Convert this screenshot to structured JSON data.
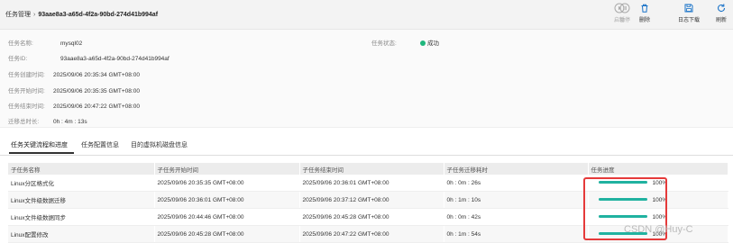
{
  "breadcrumb": {
    "parent": "任务管理",
    "separator": "›",
    "current": "93aae8a3-a65d-4f2a-90bd-274d41b994af"
  },
  "toolbar": [
    {
      "label": "启动",
      "icon": "play-circle-icon",
      "enabled": false
    },
    {
      "label": "暂停",
      "icon": "pause-circle-icon",
      "enabled": false
    },
    {
      "label": "删除",
      "icon": "trash-icon",
      "enabled": true
    },
    {
      "label": "日志下载",
      "icon": "save-icon",
      "enabled": true
    },
    {
      "label": "刷新",
      "icon": "refresh-icon",
      "enabled": true
    }
  ],
  "info": {
    "name_label": "任务名称:",
    "name_value": "mysql02",
    "status_label": "任务状态:",
    "status_value": "成功",
    "status_color": "#20b77d",
    "id_label": "任务ID:",
    "id_value": "93aae8a3-a65d-4f2a-90bd-274d41b994af",
    "created_label": "任务创建时间:",
    "created_value": "2025/09/06 20:35:34 GMT+08:00",
    "started_label": "任务开始时间:",
    "started_value": "2025/09/06 20:35:35 GMT+08:00",
    "ended_label": "任务结束时间:",
    "ended_value": "2025/09/06 20:47:22 GMT+08:00",
    "duration_label": "迁移总时长:",
    "duration_value": "0h : 4m : 13s"
  },
  "tabs": [
    "任务关键流程和进度",
    "任务配置信息",
    "目的虚拟机磁盘信息"
  ],
  "table": {
    "headers": [
      "子任务名称",
      "子任务开始时间",
      "子任务结束时间",
      "子任务迁移耗时",
      "任务进度"
    ],
    "rows": [
      {
        "name": "Linux分区格式化",
        "start": "2025/09/06 20:35:35 GMT+08:00",
        "end": "2025/09/06 20:36:01 GMT+08:00",
        "elapsed": "0h : 0m : 26s",
        "progress": 100,
        "progress_text": "100%"
      },
      {
        "name": "Linux文件级数据迁移",
        "start": "2025/09/06 20:36:01 GMT+08:00",
        "end": "2025/09/06 20:37:12 GMT+08:00",
        "elapsed": "0h : 1m : 10s",
        "progress": 100,
        "progress_text": "100%"
      },
      {
        "name": "Linux文件级数据同步",
        "start": "2025/09/06 20:44:46 GMT+08:00",
        "end": "2025/09/06 20:45:28 GMT+08:00",
        "elapsed": "0h : 0m : 42s",
        "progress": 100,
        "progress_text": "100%"
      },
      {
        "name": "Linux配置修改",
        "start": "2025/09/06 20:45:28 GMT+08:00",
        "end": "2025/09/06 20:47:22 GMT+08:00",
        "elapsed": "0h : 1m : 54s",
        "progress": 100,
        "progress_text": "100%"
      }
    ]
  },
  "watermark": "CSDN @Huy-C",
  "colors": {
    "accent": "#1a73c8",
    "progress": "#20b2a0",
    "highlight": "#e53a3a"
  }
}
